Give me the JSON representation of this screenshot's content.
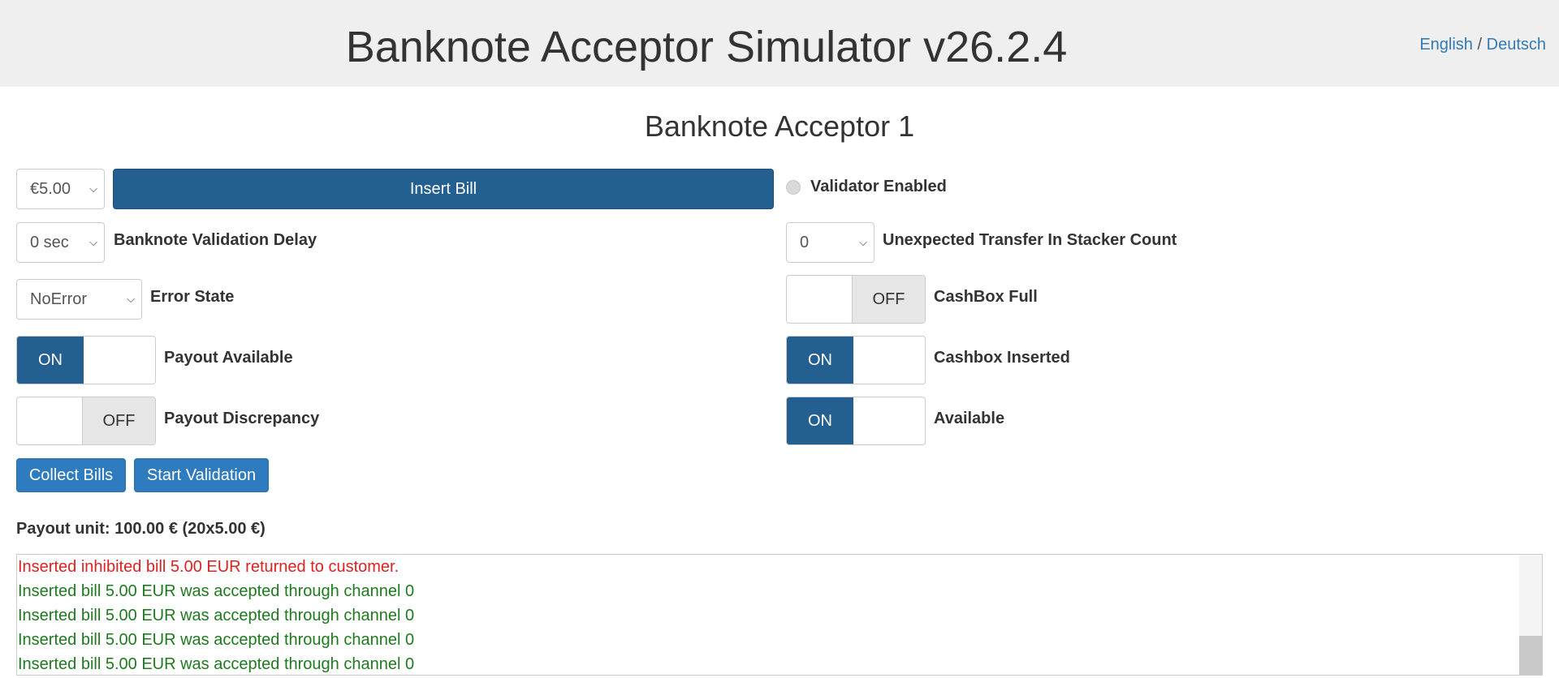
{
  "header": {
    "title": "Banknote Acceptor Simulator v26.2.4",
    "lang_english": "English",
    "lang_separator": "/",
    "lang_deutsch": "Deutsch"
  },
  "section": {
    "title": "Banknote Acceptor 1"
  },
  "controls": {
    "bill_select": {
      "value": "€5.00"
    },
    "insert_bill_label": "Insert Bill",
    "validator_enabled_label": "Validator Enabled",
    "validation_delay": {
      "value": "0 sec",
      "label": "Banknote Validation Delay"
    },
    "unexpected_transfer": {
      "value": "0",
      "label": "Unexpected Transfer In Stacker Count"
    },
    "error_state": {
      "value": "NoError",
      "label": "Error State"
    },
    "cashbox_full": {
      "state": "OFF",
      "label": "CashBox Full"
    },
    "payout_available": {
      "state": "ON",
      "label": "Payout Available"
    },
    "cashbox_inserted": {
      "state": "ON",
      "label": "Cashbox Inserted"
    },
    "payout_discrepancy": {
      "state": "OFF",
      "label": "Payout Discrepancy"
    },
    "available": {
      "state": "ON",
      "label": "Available"
    },
    "collect_bills_label": "Collect Bills",
    "start_validation_label": "Start Validation"
  },
  "payout_unit": "Payout unit: 100.00 € (20x5.00 €)",
  "log": [
    {
      "text": "Inserted inhibited bill 5.00 EUR returned to customer.",
      "type": "error"
    },
    {
      "text": "Inserted bill 5.00 EUR was accepted through channel 0",
      "type": "ok"
    },
    {
      "text": "Inserted bill 5.00 EUR was accepted through channel 0",
      "type": "ok"
    },
    {
      "text": "Inserted bill 5.00 EUR was accepted through channel 0",
      "type": "ok"
    },
    {
      "text": "Inserted bill 5.00 EUR was accepted through channel 0",
      "type": "ok"
    }
  ],
  "colors": {
    "primary": "#245f92",
    "info": "#2e7bbf",
    "link": "#337ab7",
    "log_error": "#dd2222",
    "log_ok": "#1e7a1e"
  }
}
